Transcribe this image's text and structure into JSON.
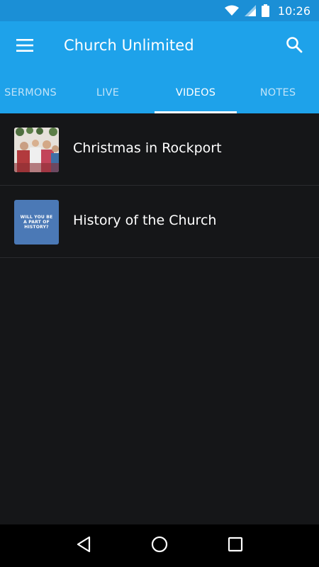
{
  "status_bar": {
    "time": "10:26",
    "icons": [
      "wifi-icon",
      "signal-icon",
      "battery-icon"
    ]
  },
  "app_bar": {
    "title": "Church Unlimited",
    "menu_icon": "menu-icon",
    "search_icon": "search-icon"
  },
  "tabs": [
    {
      "label": "SERMONS",
      "active": false
    },
    {
      "label": "LIVE",
      "active": false
    },
    {
      "label": "VIDEOS",
      "active": true
    },
    {
      "label": "NOTES",
      "active": false
    }
  ],
  "videos": [
    {
      "title": "Christmas in Rockport"
    },
    {
      "title": "History of the Church",
      "thumb_text": "WILL YOU BE A PART OF HISTORY?"
    }
  ],
  "nav_bar": {
    "icons": [
      "back-icon",
      "home-icon",
      "recents-icon"
    ]
  },
  "colors": {
    "status_bar": "#1b8fd6",
    "app_bar": "#1ea2ea",
    "background": "#151618",
    "divider": "#2a2b2e"
  }
}
